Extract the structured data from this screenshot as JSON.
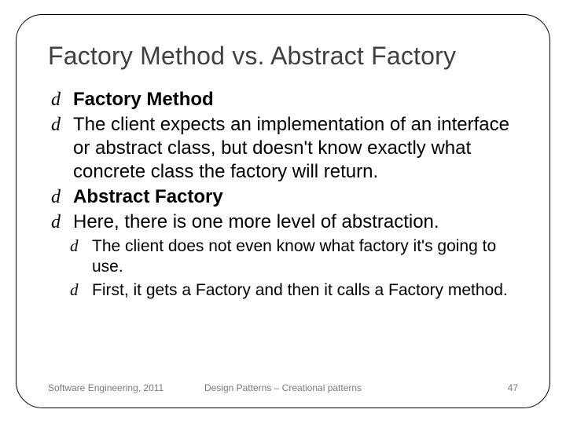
{
  "title": "Factory Method vs. Abstract Factory",
  "bullets": {
    "b1": "Factory Method",
    "b2": "The client expects an implementation of an interface or abstract class, but doesn't know exactly what concrete class the factory will return.",
    "b3": "Abstract Factory",
    "b4": "Here, there is one more level of abstraction.",
    "b5": "The client does not even know what factory it's going to use.",
    "b6": "First, it gets a Factory and then it calls a Factory method."
  },
  "bullet_glyph": "d",
  "footer": {
    "left": "Software Engineering, 2011",
    "center": "Design Patterns – Creational patterns",
    "right": "47"
  }
}
